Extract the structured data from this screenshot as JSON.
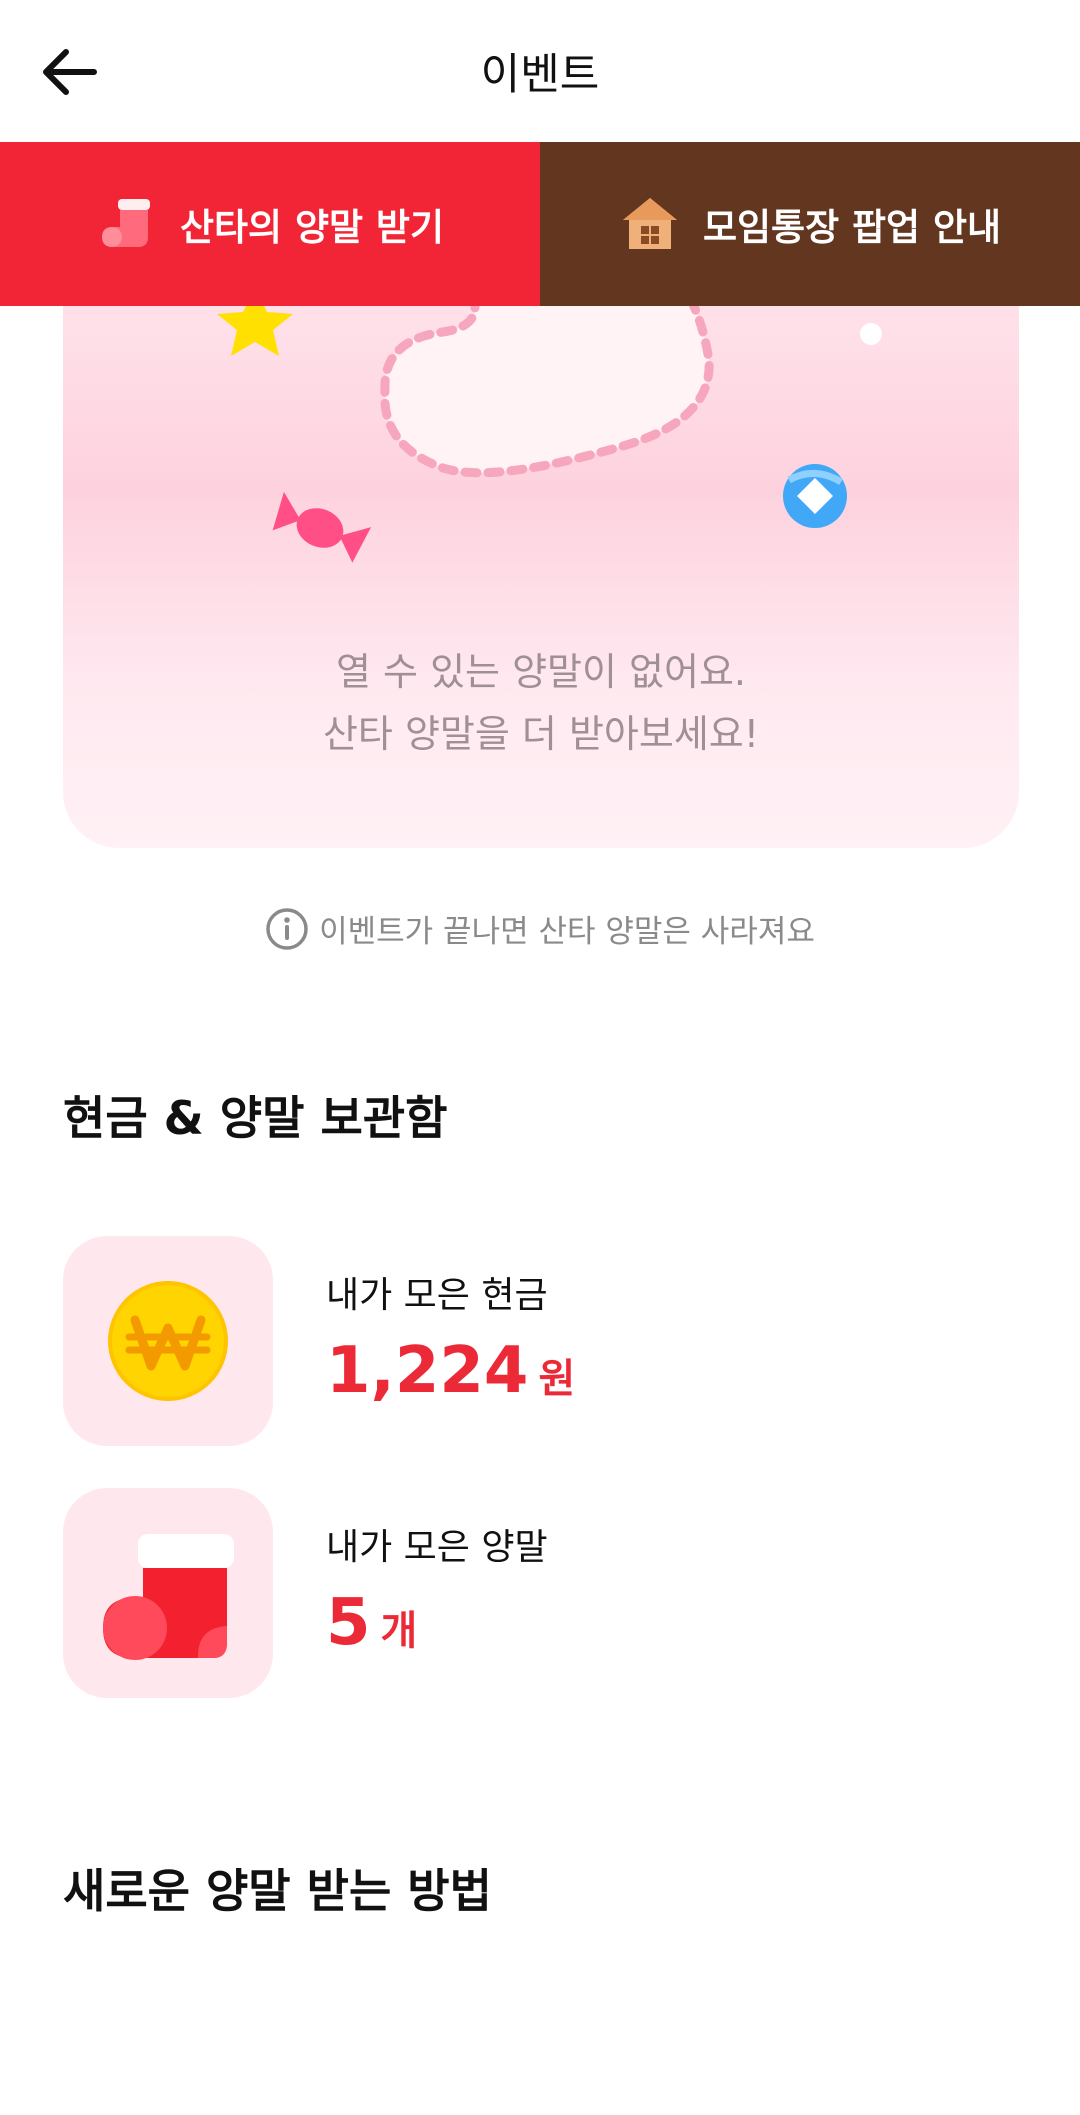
{
  "header": {
    "title": "이벤트",
    "back_icon": "arrow-left-icon"
  },
  "tabs": [
    {
      "label": "산타의 양말 받기",
      "icon": "sock-icon",
      "color": "#f12535"
    },
    {
      "label": "모임통장 팝업 안내",
      "icon": "house-icon",
      "color": "#62361f"
    }
  ],
  "sock_card": {
    "empty_line1": "열 수 있는 양말이 없어요.",
    "empty_line2": "산타 양말을 더 받아보세요!"
  },
  "notice": {
    "text": "이벤트가 끝나면 산타 양말은 사라져요",
    "icon": "info-icon"
  },
  "stash": {
    "title": "현금 & 양말 보관함",
    "cash": {
      "label": "내가 모은 현금",
      "value": "1,224",
      "unit": "원",
      "icon": "won-coin-icon"
    },
    "socks": {
      "label": "내가 모은 양말",
      "value": "5",
      "unit": "개",
      "icon": "sock-icon"
    }
  },
  "how_to": {
    "title": "새로운 양말 받는 방법"
  },
  "colors": {
    "accent_red": "#ec2a37",
    "tab_red": "#f12535",
    "tab_brown": "#62361f",
    "card_pink": "#ffe7ee"
  }
}
